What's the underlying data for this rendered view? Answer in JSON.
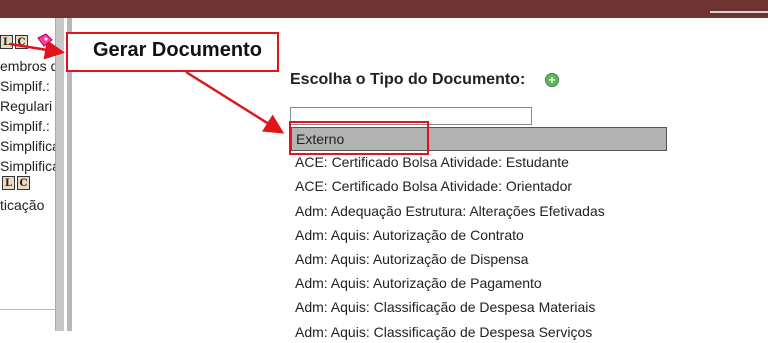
{
  "left_tree": {
    "lines": [
      "embros d",
      "Simplif.:",
      "Regulari",
      "Simplif.:",
      "Simplifica",
      "Simplifica",
      "ticação"
    ],
    "icons_row1": [
      "L",
      "C"
    ],
    "icons_row2": [
      "L",
      "C"
    ]
  },
  "main": {
    "heading": "Escolha o Tipo do Documento:",
    "type_input_value": "",
    "options": [
      "Externo",
      "ACE: Certificado Bolsa Atividade: Estudante",
      "ACE: Certificado Bolsa Atividade: Orientador",
      "Adm: Adequação Estrutura: Alterações Efetivadas",
      "Adm: Aquis: Autorização de Contrato",
      "Adm: Aquis: Autorização de Dispensa",
      "Adm: Aquis: Autorização de Pagamento",
      "Adm: Aquis: Classificação de Despesa Materiais",
      "Adm: Aquis: Classificação de Despesa Serviços"
    ],
    "selected_index": 0
  },
  "annotation": {
    "callout_label": "Gerar Documento",
    "color": "#e0141a"
  },
  "colors": {
    "topbar": "#6e3434",
    "add_icon": "#5cb85c",
    "selected_option": "#b3b3b3"
  }
}
